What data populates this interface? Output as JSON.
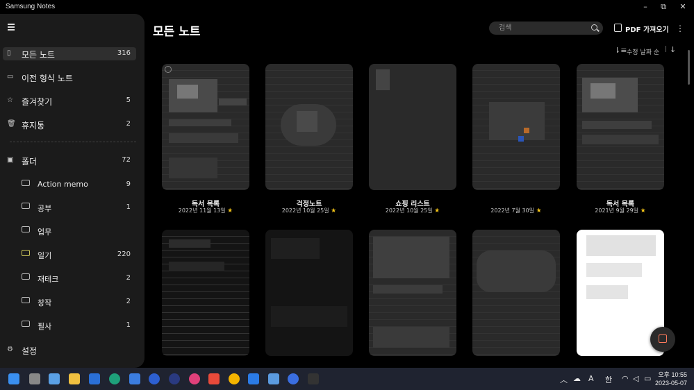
{
  "window": {
    "title": "Samsung Notes",
    "controls": {
      "minimize": "–",
      "restore": "⧉",
      "close": "✕"
    }
  },
  "sidebar": {
    "items": [
      {
        "label": "모든 노트",
        "count": "316",
        "icon": "note-icon",
        "active": true
      },
      {
        "label": "이전 형식 노트",
        "count": "",
        "icon": "legacy-note-icon"
      },
      {
        "label": "즐겨찾기",
        "count": "5",
        "icon": "star-icon"
      },
      {
        "label": "휴지통",
        "count": "2",
        "icon": "trash-icon"
      }
    ],
    "folders": {
      "label": "폴더",
      "count": "72",
      "icon": "folder-icon"
    },
    "subfolders": [
      {
        "label": "Action memo",
        "count": "9"
      },
      {
        "label": "공부",
        "count": "1"
      },
      {
        "label": "업무",
        "count": ""
      },
      {
        "label": "일기",
        "count": "220",
        "color": "#c9c35a"
      },
      {
        "label": "재테크",
        "count": "2"
      },
      {
        "label": "창작",
        "count": "2"
      },
      {
        "label": "필사",
        "count": "1"
      }
    ],
    "settings": {
      "label": "설정",
      "icon": "gear-icon"
    }
  },
  "header": {
    "title": "모든 노트",
    "search_placeholder": "검색",
    "pdf_label": "PDF 가져오기",
    "sort_label": "수정 날짜 순",
    "sort_separator": "|"
  },
  "notes": [
    {
      "title": "독서 목록",
      "date": "2022년 11월 13일",
      "favorite": true
    },
    {
      "title": "걱정노트",
      "date": "2022년 10월 25일",
      "favorite": true
    },
    {
      "title": "쇼핑 리스트",
      "date": "2022년 10월 25일",
      "favorite": true
    },
    {
      "title": "",
      "date": "2022년 7월 30일",
      "favorite": true
    },
    {
      "title": "독서 목록",
      "date": "2021년 9월 29일",
      "favorite": true
    }
  ],
  "taskbar": {
    "ime_mode": "A",
    "ime_lang": "한",
    "time": "오후 10:55",
    "date": "2023-05-07"
  },
  "colors": {
    "accent": "#ff7a5c",
    "star": "#f5c518",
    "folder_highlight": "#c9c35a"
  }
}
